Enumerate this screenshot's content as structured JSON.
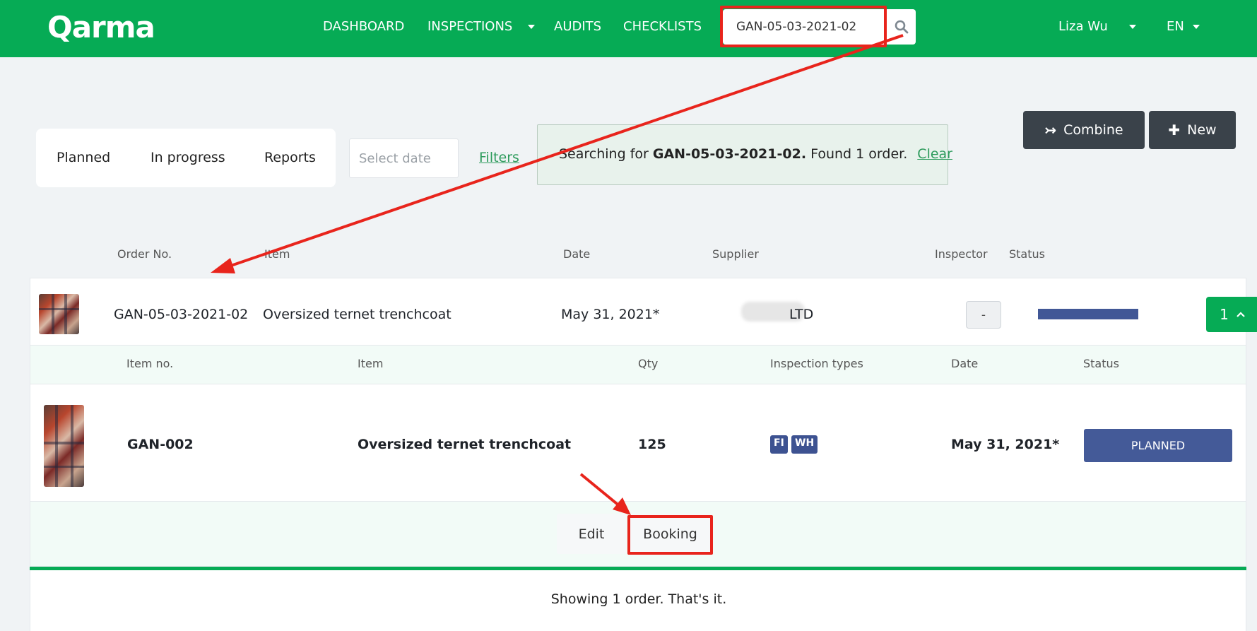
{
  "header": {
    "logo": "Qarma",
    "nav": {
      "dashboard": "DASHBOARD",
      "inspections": "INSPECTIONS",
      "audits": "AUDITS",
      "checklists": "CHECKLISTS"
    },
    "search_value": "GAN-05-03-2021-02",
    "user_name": "Liza Wu",
    "language": "EN"
  },
  "toolbar": {
    "tabs": {
      "planned": "Planned",
      "in_progress": "In progress",
      "reports": "Reports"
    },
    "date_placeholder": "Select date",
    "filters_label": "Filters",
    "search_info": {
      "prefix": "Searching for",
      "term": "GAN-05-03-2021-02.",
      "found": "Found 1 order.",
      "clear_label": "Clear"
    },
    "combine_label": "Combine",
    "new_label": "New"
  },
  "orders_table": {
    "columns": {
      "order_no": "Order No.",
      "item": "Item",
      "date": "Date",
      "supplier": "Supplier",
      "inspector": "Inspector",
      "status": "Status"
    },
    "order": {
      "order_no": "GAN-05-03-2021-02",
      "item": "Oversized ternet trenchcoat",
      "date": "May 31, 2021*",
      "supplier_suffix": "LTD",
      "inspector": "-",
      "expand_count": "1",
      "status_color": "#415796"
    }
  },
  "items_table": {
    "columns": {
      "item_no": "Item no.",
      "item": "Item",
      "qty": "Qty",
      "inspection_types": "Inspection types",
      "date": "Date",
      "status": "Status"
    },
    "item": {
      "item_no": "GAN-002",
      "item": "Oversized ternet trenchcoat",
      "qty": "125",
      "inspection_types": [
        "FI",
        "WH"
      ],
      "date": "May 31, 2021*",
      "status": "PLANNED"
    },
    "actions": {
      "edit": "Edit",
      "booking": "Booking"
    }
  },
  "footer": {
    "summary": "Showing 1 order. That's it."
  },
  "colors": {
    "brand_green": "#06ab55",
    "status_blue": "#445a98",
    "annotation_red": "#e8241c"
  }
}
